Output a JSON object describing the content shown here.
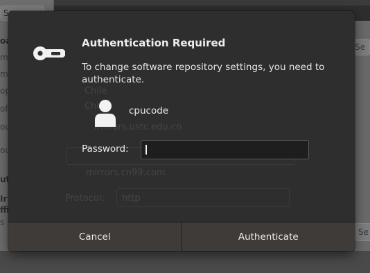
{
  "background": {
    "left_tab": "Sc",
    "left_fragments": [
      "oa",
      "m",
      "me",
      "op",
      "ofte",
      "ou",
      "ource",
      "uthentic",
      "Ir",
      "ffic",
      "s"
    ],
    "right_field": "Select Best Se",
    "right_field2": "Se",
    "ghost_text": {
      "chile": "Chile",
      "chi": "Chi",
      "mirror1": "mirrors.ustc.edu.cn",
      "mirror2": "mirrors.cn99.com",
      "protocol_label": "Protocol:",
      "protocol_value": "http"
    }
  },
  "dialog": {
    "title": "Authentication Required",
    "message": "To change software repository settings, you need to authenticate.",
    "username": "cpucode",
    "password_label": "Password:",
    "password_value": "",
    "buttons": {
      "cancel": "Cancel",
      "authenticate": "Authenticate"
    }
  },
  "colors": {
    "dialog_bg": "#2e2e2e",
    "button_bg": "#3e3b38",
    "text": "#ececec",
    "input_bg": "#1e1e1e"
  },
  "icons": {
    "dialog_icon": "key-icon",
    "user_icon": "user-avatar-icon"
  }
}
